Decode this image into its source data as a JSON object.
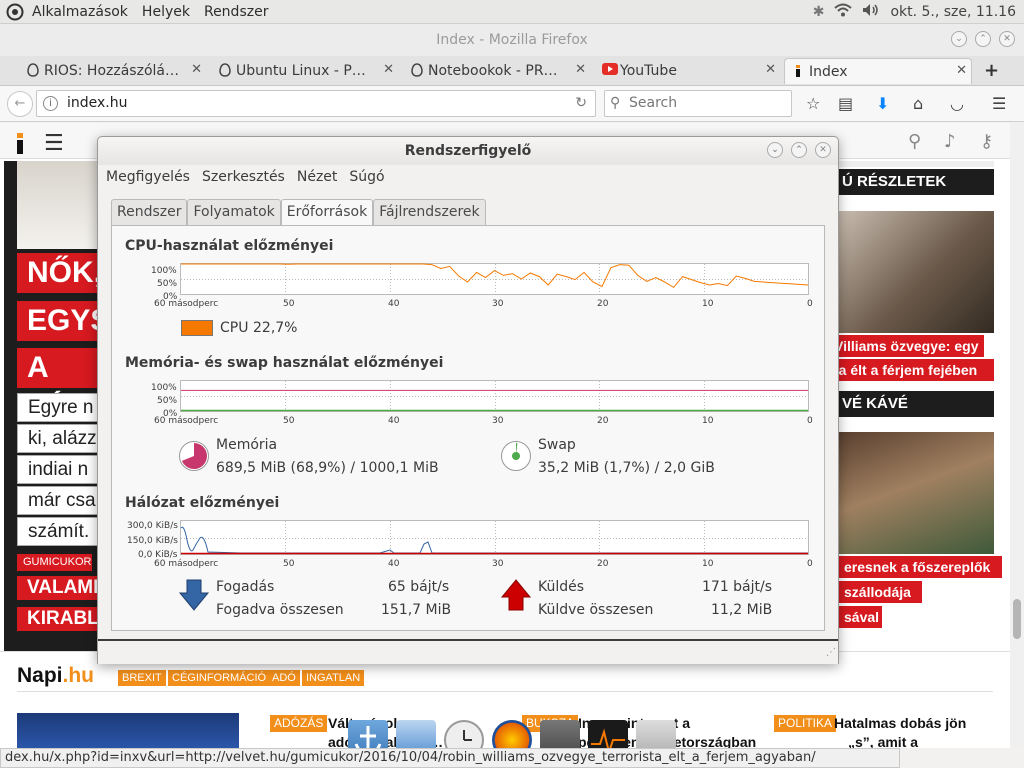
{
  "panel": {
    "menu": [
      "Alkalmazások",
      "Helyek",
      "Rendszer"
    ],
    "clock": "okt. 5., sze, 11.16"
  },
  "firefox": {
    "title": "Index - Mozilla Firefox",
    "tabs": [
      {
        "label": "RIOS: Hozzászólá…"
      },
      {
        "label": "Ubuntu Linux - P…"
      },
      {
        "label": "Notebookok - PR…"
      },
      {
        "label": "YouTube"
      },
      {
        "label": "Index"
      }
    ],
    "url": "index.hu",
    "search_placeholder": "Search",
    "status_url": "dex.hu/x.php?id=inxv&url=http://velvet.hu/gumicukor/2016/10/04/robin_williams_ozvegye_terrorista_elt_a_ferjem_agyaban/"
  },
  "page": {
    "headlines_left": [
      "NŐK,",
      "EGYS",
      "A FÉR"
    ],
    "lines_left": [
      "Egyre n",
      "ki, alázz",
      "indiai n",
      "már csa",
      "számít."
    ],
    "gumicukor": "GUMICUKOR",
    "red_small": [
      "VALAMI",
      "KIRABL"
    ],
    "right_hdr1": "Ú RÉSZLETEK",
    "right_cap1": [
      "Villiams özvegye: egy",
      "ta élt a férjem fejében"
    ],
    "right_hdr2": "VÉ KÁVÉ",
    "right_cap2": [
      "eresnek a főszereplők",
      "szállodája",
      "sával"
    ],
    "napi": {
      "name": "Napi",
      "tld": ".hu",
      "tags": [
        "BREXIT",
        "CÉGINFORMÁCIÓ",
        "ADÓ",
        "INGATLAN"
      ]
    },
    "news": [
      {
        "tag": "ADÓZÁS",
        "text": "Változások az adóhivatalnál, i…?"
      },
      {
        "tag": "BUKSZA",
        "text": "Ingyen internet a"
      },
      {
        "tag": "POLITIKA",
        "text": "Hatalmas dobás jön"
      }
    ],
    "news_line2": [
      "pénteken Németországban",
      "„s”, amit a"
    ]
  },
  "sysmon": {
    "title": "Rendszerfigyelő",
    "menu": [
      "Megfigyelés",
      "Szerkesztés",
      "Nézet",
      "Súgó"
    ],
    "tabs": [
      "Rendszer",
      "Folyamatok",
      "Erőforrások",
      "Fájlrendszerek"
    ],
    "active_tab": 2,
    "cpu": {
      "title": "CPU-használat előzményei",
      "label": "CPU",
      "value": "22,7%",
      "color": "#f57900",
      "yticks": [
        "100%",
        "50%",
        "0%"
      ],
      "xticks": [
        "60 másodperc",
        "50",
        "40",
        "30",
        "20",
        "10",
        "0"
      ],
      "history": [
        100,
        100,
        100,
        100,
        100,
        100,
        100,
        100,
        100,
        100,
        100,
        100,
        99,
        100,
        100,
        100,
        100,
        100,
        100,
        100,
        100,
        100,
        100,
        100,
        100,
        100,
        100,
        100,
        98,
        85,
        92,
        60,
        40,
        72,
        55,
        78,
        62,
        68,
        50,
        70,
        58,
        30,
        66,
        58,
        48,
        72,
        40,
        25,
        88,
        98,
        96,
        62,
        42,
        55,
        40,
        22,
        58,
        48,
        38,
        30,
        35,
        28,
        60,
        52,
        42,
        40,
        38,
        36,
        34,
        32,
        30
      ]
    },
    "mem": {
      "title": "Memória- és swap használat előzményei",
      "mem_label": "Memória",
      "mem_value": "689,5 MiB (68,9%) / 1000,1 MiB",
      "mem_color": "#c8366e",
      "swap_label": "Swap",
      "swap_value": "35,2 MiB (1,7%) / 2,0 GiB",
      "swap_color": "#4ea94b",
      "mem_percent": 68.9,
      "swap_percent": 1.7,
      "yticks": [
        "100%",
        "50%",
        "0%"
      ],
      "xticks": [
        "60 másodperc",
        "50",
        "40",
        "30",
        "20",
        "10",
        "0"
      ]
    },
    "net": {
      "title": "Hálózat előzményei",
      "yticks": [
        "300,0 KiB/s",
        "150,0 KiB/s",
        "0,0 KiB/s"
      ],
      "xticks": [
        "60 másodperc",
        "50",
        "40",
        "30",
        "20",
        "10",
        "0"
      ],
      "recv_label": "Fogadás",
      "recv_value": "65 bájt/s",
      "recv_total_label": "Fogadva összesen",
      "recv_total": "151,7 MiB",
      "recv_color": "#3465a4",
      "send_label": "Küldés",
      "send_value": "171 bájt/s",
      "send_total_label": "Küldve összesen",
      "send_total": "11,2 MiB",
      "send_color": "#cc0000"
    }
  }
}
